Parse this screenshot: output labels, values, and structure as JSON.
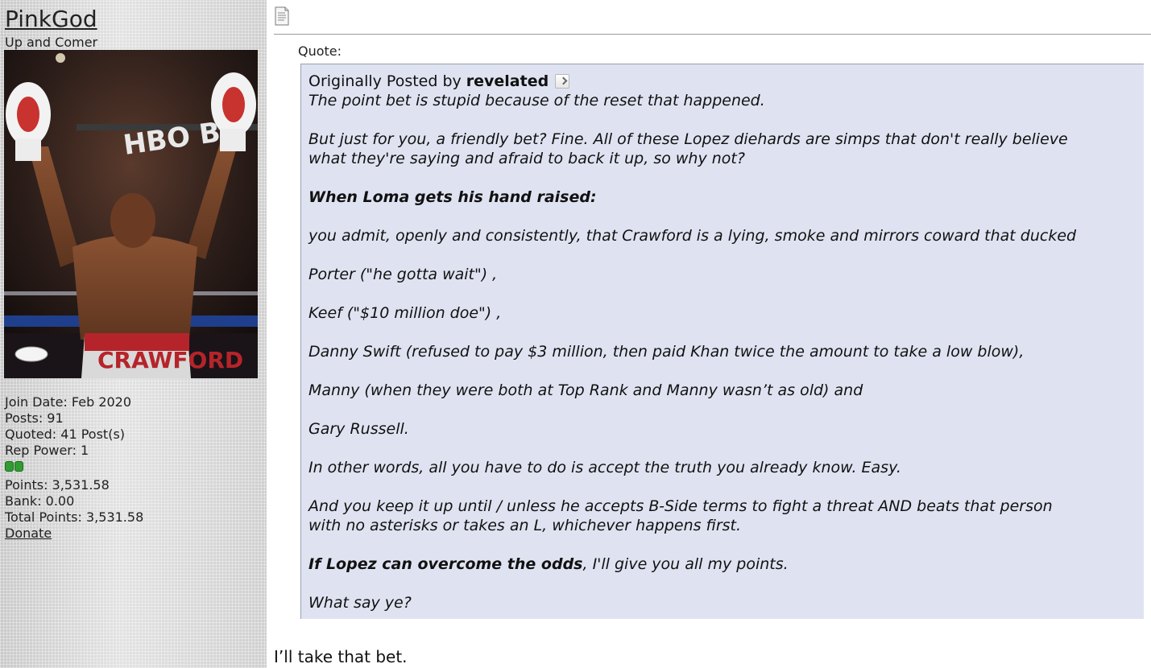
{
  "user": {
    "username": "PinkGod",
    "title": "Up and Comer",
    "avatar_banner": "HBO BO",
    "avatar_trunks": "CRAWFORD",
    "join_date": "Join Date: Feb 2020",
    "posts": "Posts: 91",
    "quoted": "Quoted: 41 Post(s)",
    "rep_power": "Rep Power: 1",
    "points": "Points: 3,531.58",
    "bank": "Bank: 0.00",
    "total_points": "Total Points: 3,531.58",
    "donate": "Donate",
    "rep_color": "#2f9d2f"
  },
  "post": {
    "icon": "document-icon",
    "quote_label": "Quote:",
    "originally_posted_by": "Originally Posted by",
    "author": "revelated",
    "quote_bg": "#dfe3f1",
    "paragraphs": {
      "p1": "The point bet is stupid because of the reset that happened.",
      "p2a": "But just for you, a friendly bet? Fine. All of these Lopez diehards are simps that don't really believe",
      "p2b": "what they're saying and afraid to back it up, so why not?",
      "p3": "When Loma gets his hand raised:",
      "p4": "you admit, openly and consistently, that Crawford is a lying, smoke and mirrors coward that ducked",
      "p5": "Porter (\"he gotta wait\") ,",
      "p6": "Keef (\"$10 million doe\") ,",
      "p7": "Danny Swift (refused to pay $3 million, then paid Khan twice the amount to take a low blow),",
      "p8": "Manny (when they were both at Top Rank and Manny wasn’t as old) and",
      "p9": "Gary Russell.",
      "p10": "In other words, all you have to do is accept the truth you already know. Easy.",
      "p11a": "And you keep it up until / unless he accepts B-Side terms to fight a threat AND beats that person",
      "p11b": "with no asterisks or takes an L, whichever happens first.",
      "p12_bold": "If Lopez can overcome the odds",
      "p12_rest": ", I'll give you all my points.",
      "p13": "What say ye?"
    },
    "reply": "I’ll take that bet."
  }
}
